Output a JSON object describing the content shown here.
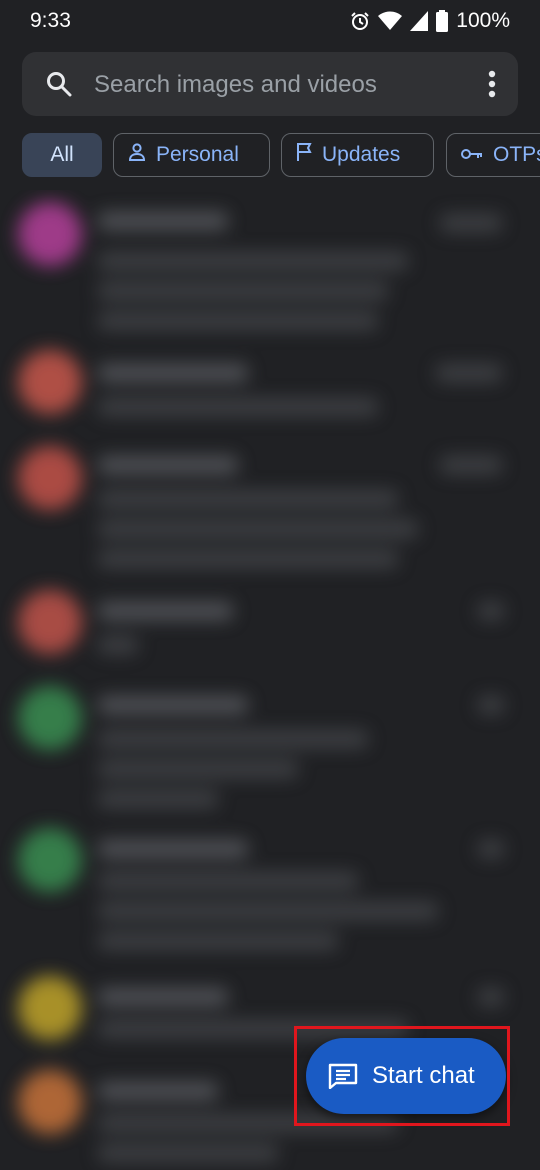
{
  "status_bar": {
    "time": "9:33",
    "battery": "100%"
  },
  "search": {
    "placeholder": "Search images and videos"
  },
  "chips": [
    {
      "label": "All",
      "icon": "none",
      "selected": true
    },
    {
      "label": "Personal",
      "icon": "person-icon",
      "selected": false
    },
    {
      "label": "Updates",
      "icon": "flag-icon",
      "selected": false
    },
    {
      "label": "OTPs",
      "icon": "key-icon",
      "selected": false
    }
  ],
  "conversations": [
    {
      "avatar_color": "#b5409b"
    },
    {
      "avatar_color": "#c9584c"
    },
    {
      "avatar_color": "#c4534a"
    },
    {
      "avatar_color": "#c1544b"
    },
    {
      "avatar_color": "#3a8f52"
    },
    {
      "avatar_color": "#3a8f52"
    },
    {
      "avatar_color": "#c1a52a"
    },
    {
      "avatar_color": "#c8733a"
    }
  ],
  "fab": {
    "label": "Start chat"
  },
  "colors": {
    "background": "#202124",
    "accent": "#8ab4f8",
    "fab": "#1a5bc4",
    "highlight": "#e0161d"
  }
}
